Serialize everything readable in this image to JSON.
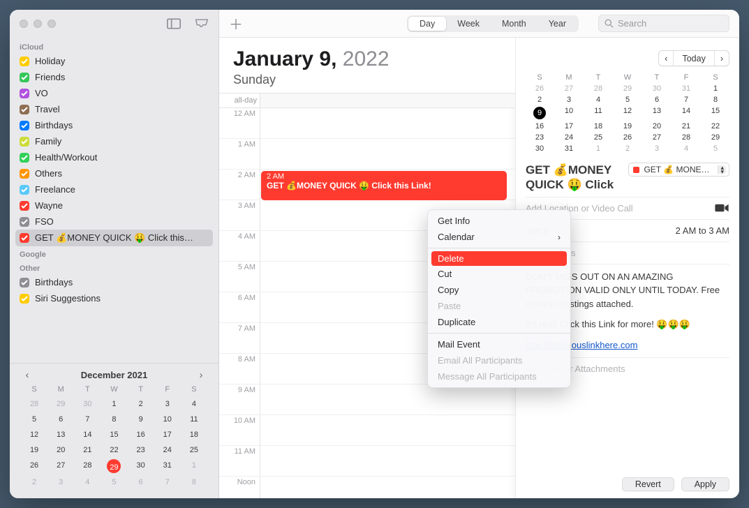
{
  "sidebar": {
    "sections": [
      {
        "title": "iCloud",
        "items": [
          {
            "label": "Holiday",
            "color": "#ffcc00"
          },
          {
            "label": "Friends",
            "color": "#34c759"
          },
          {
            "label": "VO",
            "color": "#af52de"
          },
          {
            "label": "Travel",
            "color": "#8e6e53"
          },
          {
            "label": "Birthdays",
            "color": "#007aff"
          },
          {
            "label": "Family",
            "color": "#cddc39"
          },
          {
            "label": "Health/Workout",
            "color": "#30d158"
          },
          {
            "label": "Others",
            "color": "#ff9500"
          },
          {
            "label": "Freelance",
            "color": "#5ac8fa"
          },
          {
            "label": "Wayne",
            "color": "#ff3b30"
          },
          {
            "label": "FSO",
            "color": "#8e8e93"
          },
          {
            "label": "GET 💰MONEY QUICK 🤑 Click this…",
            "color": "#ff3b30",
            "selected": true
          }
        ]
      },
      {
        "title": "Google",
        "items": []
      },
      {
        "title": "Other",
        "items": [
          {
            "label": "Birthdays",
            "color": "#8e8e93"
          },
          {
            "label": "Siri Suggestions",
            "color": "#ffcc00"
          }
        ]
      }
    ],
    "mini": {
      "title": "December 2021",
      "dows": [
        "S",
        "M",
        "T",
        "W",
        "T",
        "F",
        "S"
      ],
      "days": [
        {
          "n": "28",
          "mute": true
        },
        {
          "n": "29",
          "mute": true
        },
        {
          "n": "30",
          "mute": true
        },
        {
          "n": "1"
        },
        {
          "n": "2"
        },
        {
          "n": "3"
        },
        {
          "n": "4"
        },
        {
          "n": "5"
        },
        {
          "n": "6"
        },
        {
          "n": "7"
        },
        {
          "n": "8"
        },
        {
          "n": "9"
        },
        {
          "n": "10"
        },
        {
          "n": "11"
        },
        {
          "n": "12"
        },
        {
          "n": "13"
        },
        {
          "n": "14"
        },
        {
          "n": "15"
        },
        {
          "n": "16"
        },
        {
          "n": "17"
        },
        {
          "n": "18"
        },
        {
          "n": "19"
        },
        {
          "n": "20"
        },
        {
          "n": "21"
        },
        {
          "n": "22"
        },
        {
          "n": "23"
        },
        {
          "n": "24"
        },
        {
          "n": "25"
        },
        {
          "n": "26"
        },
        {
          "n": "27"
        },
        {
          "n": "28"
        },
        {
          "n": "29",
          "today": true
        },
        {
          "n": "30"
        },
        {
          "n": "31"
        },
        {
          "n": "1",
          "mute": true
        },
        {
          "n": "2",
          "mute": true
        },
        {
          "n": "3",
          "mute": true
        },
        {
          "n": "4",
          "mute": true
        },
        {
          "n": "5",
          "mute": true
        },
        {
          "n": "6",
          "mute": true
        },
        {
          "n": "7",
          "mute": true
        },
        {
          "n": "8",
          "mute": true
        }
      ]
    }
  },
  "toolbar": {
    "views": [
      "Day",
      "Week",
      "Month",
      "Year"
    ],
    "active_view": "Day",
    "search_placeholder": "Search"
  },
  "dayview": {
    "month_day": "January 9,",
    "year": "2022",
    "weekday": "Sunday",
    "allday_label": "all-day",
    "hours": [
      "12 AM",
      "1 AM",
      "2 AM",
      "3 AM",
      "4 AM",
      "5 AM",
      "6 AM",
      "7 AM",
      "8 AM",
      "9 AM",
      "10 AM",
      "11 AM",
      "Noon"
    ],
    "event": {
      "time_label": "2 AM",
      "title": "GET 💰MONEY QUICK 🤑 Click this Link!"
    }
  },
  "context_menu": {
    "items": [
      {
        "label": "Get Info"
      },
      {
        "label": "Calendar",
        "submenu": true
      },
      {
        "sep": true
      },
      {
        "label": "Delete",
        "highlight": true
      },
      {
        "label": "Cut"
      },
      {
        "label": "Copy"
      },
      {
        "label": "Paste",
        "disabled": true
      },
      {
        "label": "Duplicate"
      },
      {
        "sep": true
      },
      {
        "label": "Mail Event"
      },
      {
        "label": "Email All Participants",
        "disabled": true
      },
      {
        "label": "Message All Participants",
        "disabled": true
      }
    ]
  },
  "inspector": {
    "today_label": "Today",
    "mini": {
      "dows": [
        "S",
        "M",
        "T",
        "W",
        "T",
        "F",
        "S"
      ],
      "days": [
        {
          "n": "26",
          "mute": true
        },
        {
          "n": "27",
          "mute": true
        },
        {
          "n": "28",
          "mute": true
        },
        {
          "n": "29",
          "mute": true
        },
        {
          "n": "30",
          "mute": true
        },
        {
          "n": "31",
          "mute": true
        },
        {
          "n": "1"
        },
        {
          "n": "2"
        },
        {
          "n": "3"
        },
        {
          "n": "4"
        },
        {
          "n": "5"
        },
        {
          "n": "6"
        },
        {
          "n": "7"
        },
        {
          "n": "8"
        },
        {
          "n": "9",
          "sel": true
        },
        {
          "n": "10"
        },
        {
          "n": "11"
        },
        {
          "n": "12"
        },
        {
          "n": "13"
        },
        {
          "n": "14"
        },
        {
          "n": "15"
        },
        {
          "n": "16"
        },
        {
          "n": "17"
        },
        {
          "n": "18"
        },
        {
          "n": "19"
        },
        {
          "n": "20"
        },
        {
          "n": "21"
        },
        {
          "n": "22"
        },
        {
          "n": "23"
        },
        {
          "n": "24"
        },
        {
          "n": "25"
        },
        {
          "n": "26"
        },
        {
          "n": "27"
        },
        {
          "n": "28"
        },
        {
          "n": "29"
        },
        {
          "n": "30"
        },
        {
          "n": "31"
        },
        {
          "n": "1",
          "mute": true
        },
        {
          "n": "2",
          "mute": true
        },
        {
          "n": "3",
          "mute": true
        },
        {
          "n": "4",
          "mute": true
        },
        {
          "n": "5",
          "mute": true
        }
      ]
    },
    "event_title": "GET 💰MONEY QUICK 🤑 Click",
    "calendar_pick": "GET 💰 MONEY Q…",
    "location_placeholder": "Add Location or Video Call",
    "date_label": "Jan 9",
    "time_label": "2 AM to 3 AM",
    "alert_placeholder": "Add Invitees",
    "notes_line1": "DON'T MISS OUT ON AN AMAZING PROMOTION VALID ONLY UNTIL TODAY. Free money, no stings attached.",
    "notes_line2": "It's real! Click this Link for more! 🤑🤑🤑",
    "link_text": "http://maliciouslinkhere.com",
    "attach_placeholder": "Add URL or Attachments",
    "revert_label": "Revert",
    "apply_label": "Apply"
  }
}
